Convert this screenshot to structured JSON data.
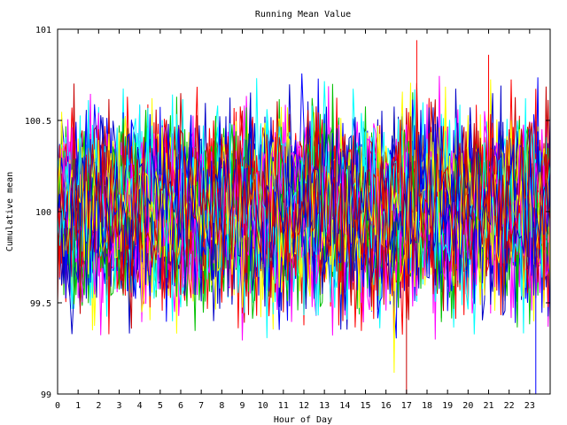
{
  "chart_data": {
    "type": "line",
    "title": "Running Mean Value",
    "xlabel": "Hour of Day",
    "ylabel": "Cumulative mean",
    "xlim": [
      0,
      24
    ],
    "ylim": [
      99,
      101
    ],
    "x_ticks": [
      "0",
      "1",
      "2",
      "3",
      "4",
      "5",
      "6",
      "7",
      "8",
      "9",
      "10",
      "11",
      "12",
      "13",
      "14",
      "15",
      "16",
      "17",
      "18",
      "19",
      "20",
      "21",
      "22",
      "23"
    ],
    "y_ticks": [
      "99",
      "99.5",
      "100",
      "100.5",
      "101"
    ],
    "grid": false,
    "legend": "none",
    "series_colors": [
      "#ff0000",
      "#00c000",
      "#0000ff",
      "#ff00ff",
      "#00ffff",
      "#ffff00",
      "#0000c8",
      "#c80000"
    ],
    "series_count": 48,
    "point_count": 240,
    "center_value": 100,
    "typical_range": [
      99.5,
      100.5
    ],
    "extremes": [
      {
        "x": 17.0,
        "y": 99.0
      },
      {
        "x": 17.5,
        "y": 100.94
      },
      {
        "x": 21.0,
        "y": 100.86
      },
      {
        "x": 23.3,
        "y": 99.0
      }
    ]
  }
}
